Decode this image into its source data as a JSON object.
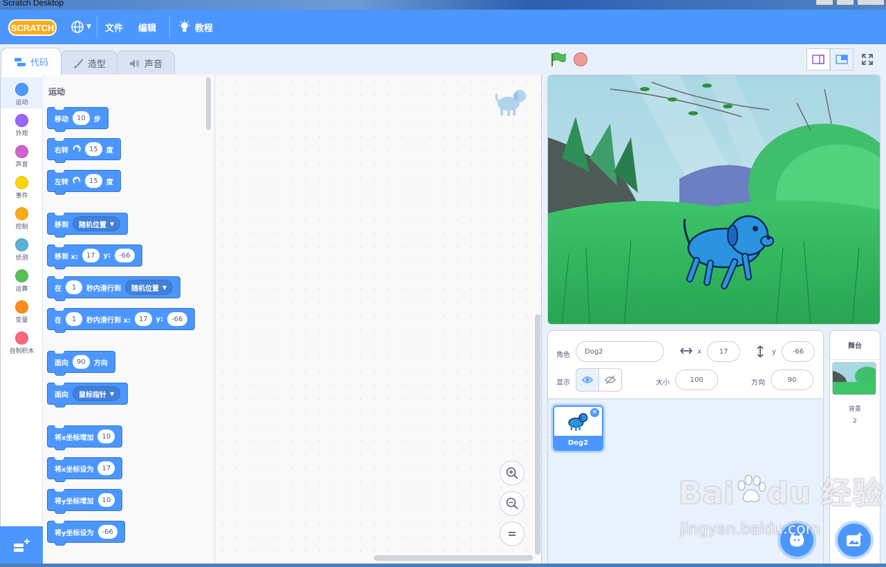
{
  "window": {
    "title": "Scratch Desktop"
  },
  "menubar": {
    "logo_text": "SCRATCH",
    "file": "文件",
    "edit": "编辑",
    "tutorials": "教程"
  },
  "tabs": {
    "code": "代码",
    "costumes": "造型",
    "sounds": "声音"
  },
  "categories": [
    {
      "label": "运动",
      "color": "#4c97ff"
    },
    {
      "label": "外观",
      "color": "#9966ff"
    },
    {
      "label": "声音",
      "color": "#cf63cf"
    },
    {
      "label": "事件",
      "color": "#ffd500"
    },
    {
      "label": "控制",
      "color": "#ffab19"
    },
    {
      "label": "侦测",
      "color": "#5cb1d6"
    },
    {
      "label": "运算",
      "color": "#59c059"
    },
    {
      "label": "变量",
      "color": "#ff8c1a"
    },
    {
      "label": "自制积木",
      "color": "#ff6680"
    }
  ],
  "palette": {
    "section": "运动",
    "blocks": {
      "move": {
        "a": "移动",
        "v": "10",
        "b": "步"
      },
      "turn_right": {
        "a": "右转",
        "v": "15",
        "b": "度"
      },
      "turn_left": {
        "a": "左转",
        "v": "15",
        "b": "度"
      },
      "goto": {
        "a": "移到",
        "dd": "随机位置"
      },
      "goto_xy": {
        "a": "移到 x:",
        "x": "17",
        "b": "y:",
        "y": "-66"
      },
      "glide": {
        "a": "在",
        "v": "1",
        "b": "秒内滑行到",
        "dd": "随机位置"
      },
      "glide_xy": {
        "a": "在",
        "v": "1",
        "b": "秒内滑行到 x:",
        "x": "17",
        "c": "y:",
        "y": "-66"
      },
      "point_dir": {
        "a": "面向",
        "v": "90",
        "b": "方向"
      },
      "point_towards": {
        "a": "面向",
        "dd": "鼠标指针"
      },
      "change_x": {
        "a": "将x坐标增加",
        "v": "10"
      },
      "set_x": {
        "a": "将x坐标设为",
        "v": "17"
      },
      "change_y": {
        "a": "将y坐标增加",
        "v": "10"
      },
      "set_y": {
        "a": "将y坐标设为",
        "v": "-66"
      }
    }
  },
  "sprite_info": {
    "sprite_label": "角色",
    "sprite_name": "Dog2",
    "x_label": "x",
    "x": "17",
    "y_label": "y",
    "y": "-66",
    "show_label": "显示",
    "size_label": "大小",
    "size": "100",
    "direction_label": "方向",
    "direction": "90"
  },
  "sprites": [
    {
      "name": "Dog2"
    }
  ],
  "stage_pane": {
    "title": "舞台",
    "backdrops_label": "背景",
    "backdrops_count": "2"
  },
  "watermark": {
    "brand": "Bai",
    "brand_suffix": "du",
    "brand_cn": "经验",
    "url": "jingyan.baidu.com"
  }
}
